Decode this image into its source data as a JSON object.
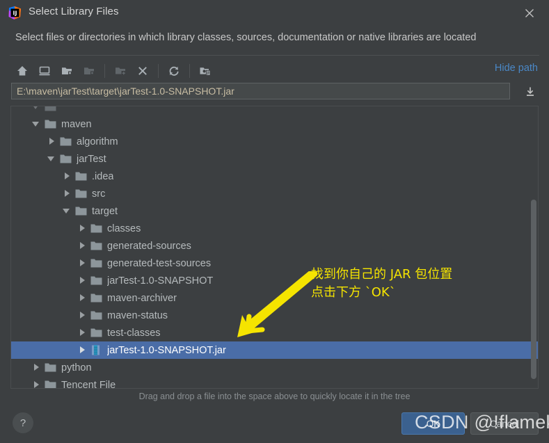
{
  "window": {
    "title": "Select Library Files",
    "logo_icon": "intellij-idea-logo",
    "close_icon": "close-icon",
    "subtitle": "Select files or directories in which library classes, sources, documentation or native libraries are located"
  },
  "toolbar": {
    "buttons": [
      {
        "name": "home-icon",
        "tooltip": "Home",
        "disabled": false
      },
      {
        "name": "desktop-icon",
        "tooltip": "Desktop",
        "disabled": false
      },
      {
        "name": "project-folder-icon",
        "tooltip": "Project",
        "disabled": false
      },
      {
        "name": "module-folder-icon",
        "tooltip": "Module",
        "disabled": true
      },
      {
        "name": "new-folder-icon",
        "tooltip": "New Folder",
        "disabled": false
      },
      {
        "name": "delete-icon",
        "tooltip": "Delete",
        "disabled": false
      },
      {
        "name": "refresh-icon",
        "tooltip": "Refresh",
        "disabled": false
      },
      {
        "name": "show-hidden-icon",
        "tooltip": "Show Hidden Files",
        "disabled": false
      }
    ],
    "hide_path_label": "Hide path"
  },
  "path_field": {
    "value": "E:\\maven\\jarTest\\target\\jarTest-1.0-SNAPSHOT.jar",
    "placeholder": "",
    "expand_icon": "download-icon"
  },
  "tree": {
    "rows": [
      {
        "label": "",
        "indent": 1,
        "twisty": "expanded",
        "icon": "folder",
        "selected": false,
        "clipped": true
      },
      {
        "label": "maven",
        "indent": 1,
        "twisty": "expanded",
        "icon": "folder",
        "selected": false
      },
      {
        "label": "algorithm",
        "indent": 2,
        "twisty": "collapsed",
        "icon": "folder",
        "selected": false
      },
      {
        "label": "jarTest",
        "indent": 2,
        "twisty": "expanded",
        "icon": "folder",
        "selected": false
      },
      {
        "label": ".idea",
        "indent": 3,
        "twisty": "collapsed",
        "icon": "folder",
        "selected": false
      },
      {
        "label": "src",
        "indent": 3,
        "twisty": "collapsed",
        "icon": "folder",
        "selected": false
      },
      {
        "label": "target",
        "indent": 3,
        "twisty": "expanded",
        "icon": "folder",
        "selected": false
      },
      {
        "label": "classes",
        "indent": 4,
        "twisty": "collapsed",
        "icon": "folder",
        "selected": false
      },
      {
        "label": "generated-sources",
        "indent": 4,
        "twisty": "collapsed",
        "icon": "folder",
        "selected": false
      },
      {
        "label": "generated-test-sources",
        "indent": 4,
        "twisty": "collapsed",
        "icon": "folder",
        "selected": false
      },
      {
        "label": "jarTest-1.0-SNAPSHOT",
        "indent": 4,
        "twisty": "collapsed",
        "icon": "folder",
        "selected": false
      },
      {
        "label": "maven-archiver",
        "indent": 4,
        "twisty": "collapsed",
        "icon": "folder",
        "selected": false
      },
      {
        "label": "maven-status",
        "indent": 4,
        "twisty": "collapsed",
        "icon": "folder",
        "selected": false
      },
      {
        "label": "test-classes",
        "indent": 4,
        "twisty": "collapsed",
        "icon": "folder",
        "selected": false
      },
      {
        "label": "jarTest-1.0-SNAPSHOT.jar",
        "indent": 4,
        "twisty": "collapsed",
        "icon": "jar",
        "selected": true
      },
      {
        "label": "python",
        "indent": 1,
        "twisty": "collapsed",
        "icon": "folder",
        "selected": false
      },
      {
        "label": "Tencent File",
        "indent": 1,
        "twisty": "collapsed",
        "icon": "folder",
        "selected": false
      }
    ],
    "scrollbar": {
      "name": "vertical-scrollbar"
    }
  },
  "hint": "Drag and drop a file into the space above to quickly locate it in the tree",
  "footer": {
    "help_label": "?",
    "ok_label": "OK",
    "cancel_label": "Cancel"
  },
  "annotation": {
    "text": "找到你自己的 JAR 包位置\n点击下方 `OK`",
    "arrow_icon": "arrow-pointing-down-left",
    "color": "#f5e400"
  },
  "watermark": "CSDN @!flameking",
  "colors": {
    "dialog_bg": "#3c3f41",
    "selection_blue": "#4a6da7",
    "link_blue": "#4a88c7",
    "ok_button_blue": "#3b618f",
    "path_text": "#c8bda3",
    "annotation_yellow": "#f5e400"
  }
}
